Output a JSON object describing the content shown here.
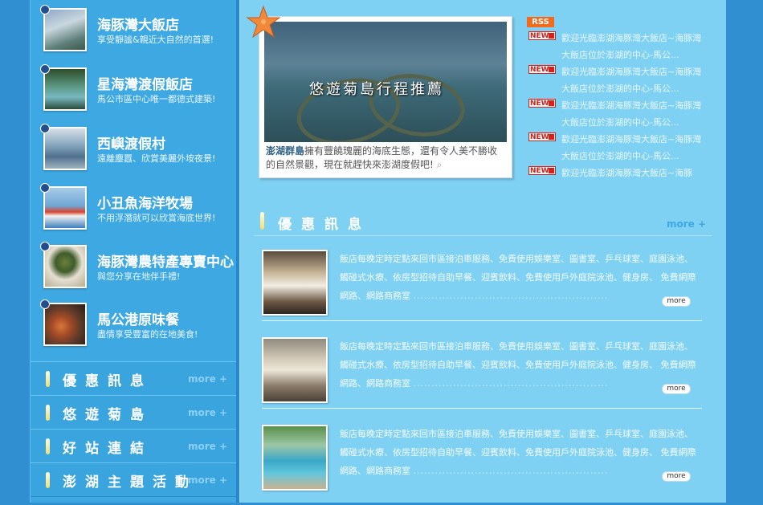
{
  "sidebar": {
    "features": [
      {
        "title": "海豚灣大飯店",
        "subtitle": "享受靜謐&親近大自然的首選!",
        "icon": "hotel-photo"
      },
      {
        "title": "星海灣渡假飯店",
        "subtitle": "馬公市區中心唯一都德式建築!",
        "icon": "hotel-photo"
      },
      {
        "title": "西嶼渡假村",
        "subtitle": "遠離塵囂、欣賞美麗外垵夜景!",
        "icon": "resort-photo"
      },
      {
        "title": "小丑魚海洋牧場",
        "subtitle": "不用浮潛就可以欣賞海底世界!",
        "icon": "boat-photo"
      },
      {
        "title": "海豚灣農特產專賣中心",
        "subtitle": "與您分享在地伴手禮!",
        "icon": "shop-photo"
      },
      {
        "title": "馬公港原味餐",
        "subtitle": "盡情享受豐富的在地美食!",
        "icon": "food-photo"
      }
    ],
    "nav": [
      {
        "label": "優惠訊息",
        "more": "more +"
      },
      {
        "label": "悠遊菊島",
        "more": "more +"
      },
      {
        "label": "好站連結",
        "more": "more +"
      },
      {
        "label": "澎湖主題活動",
        "more": "more +"
      }
    ]
  },
  "feature": {
    "caption": "悠遊菊島行程推薦",
    "text_bold": "澎湖群島",
    "text": "擁有豐饒瑰麗的海底生態，還有令人美不勝收的自然景觀，現在就趕快來澎湖度假吧!"
  },
  "news": {
    "rss": "RSS",
    "badge": "NEW",
    "items": [
      "歡迎光臨澎湖海豚灣大飯店~海豚灣大飯店位於澎湖的中心-馬公...",
      "歡迎光臨澎湖海豚灣大飯店~海豚灣大飯店位於澎湖的中心-馬公...",
      "歡迎光臨澎湖海豚灣大飯店~海豚灣大飯店位於澎湖的中心-馬公...",
      "歡迎光臨澎湖海豚灣大飯店~海豚灣大飯店位於澎湖的中心-馬公...",
      "歡迎光臨澎湖海豚灣大飯店~海豚"
    ]
  },
  "promo": {
    "title": "優惠訊息",
    "more": "more +",
    "items": [
      {
        "text": "飯店每晚定時定點來回市區接泊車服務、免費使用娛樂室、圖書室、乒乓球室、庭園泳池、觸碰式水療、依房型招待自助早餐、迎賓飲料、免費使用戶外庭院泳池、健身房、 免費網際網路、網路商務室",
        "more": "more"
      },
      {
        "text": "飯店每晚定時定點來回市區接泊車服務、免費使用娛樂室、圖書室、乒乓球室、庭園泳池、觸碰式水療、依房型招待自助早餐、迎賓飲料、免費使用戶外庭院泳池、健身房、 免費網際網路、網路商務室",
        "more": "more"
      },
      {
        "text": "飯店每晚定時定點來回市區接泊車服務、免費使用娛樂室、圖書室、乒乓球室、庭園泳池、觸碰式水療、依房型招待自助早餐、迎賓飲料、免費使用戶外庭院泳池、健身房、 免費網際網路、網路商務室",
        "more": "more"
      }
    ]
  },
  "colors": {
    "accent": "#3ea8e2",
    "content_bg": "#7fd1f4",
    "page_bg": "#2f8fd0",
    "new_badge": "#d6201a"
  }
}
